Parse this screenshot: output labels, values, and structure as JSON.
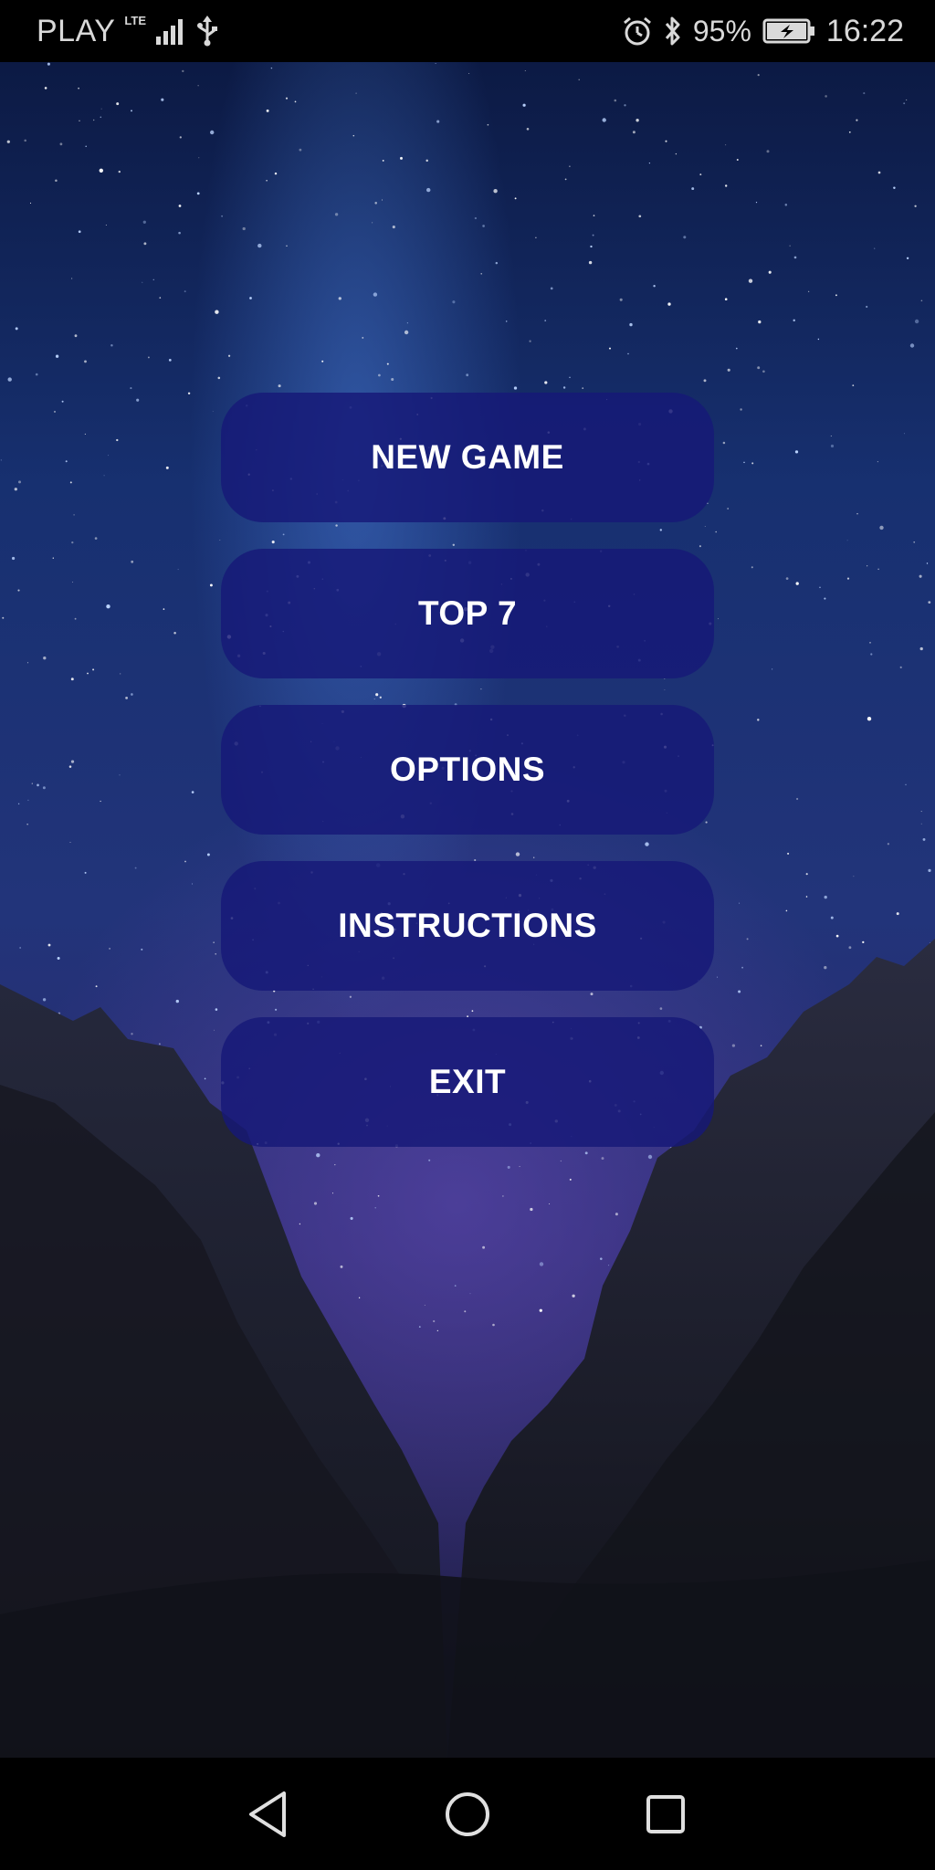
{
  "status_bar": {
    "carrier": "PLAY",
    "network_type": "LTE",
    "battery_percent": "95%",
    "time": "16:22",
    "icons": [
      "signal-icon",
      "usb-icon",
      "alarm-icon",
      "bluetooth-icon",
      "battery-charging-icon"
    ]
  },
  "menu": {
    "items": [
      {
        "label": "NEW GAME"
      },
      {
        "label": "TOP 7"
      },
      {
        "label": "OPTIONS"
      },
      {
        "label": "INSTRUCTIONS"
      },
      {
        "label": "EXIT"
      }
    ]
  },
  "nav_bar": {
    "icons": [
      "back-icon",
      "home-icon",
      "recents-icon"
    ]
  },
  "colors": {
    "button_fill": "#16187a",
    "button_text": "#ffffff",
    "status_text": "#d9d9d9",
    "bars_background": "#000000"
  }
}
